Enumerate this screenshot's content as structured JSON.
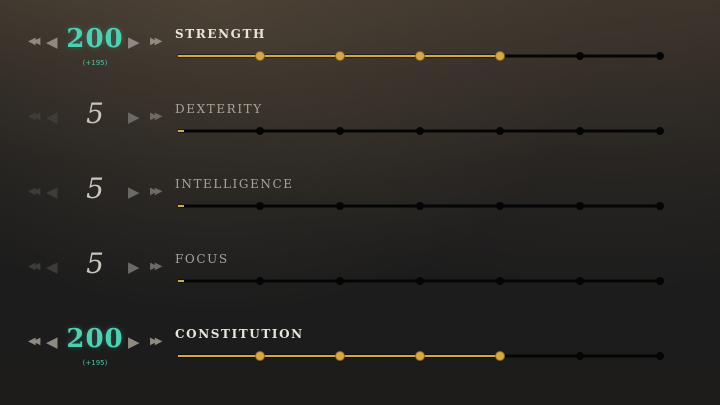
{
  "colors": {
    "accent_teal": "#4fd0b2",
    "gold": "#d4a847",
    "track_black": "#050505",
    "label_active": "#e8e4da",
    "label_inactive": "#a7a39b"
  },
  "icons": {
    "double_left": "double-chevron-left-icon",
    "single_left": "triangle-left-icon",
    "single_right": "triangle-right-icon",
    "double_right": "double-chevron-right-icon"
  },
  "glyphs": {
    "double_left": "◀◀",
    "single_left": "◀",
    "single_right": "▶",
    "double_right": "▶▶"
  },
  "track": {
    "nodes": 6
  },
  "attributes": [
    {
      "key": "strength",
      "name": "STRENGTH",
      "value": "200",
      "bonus": "(+195)",
      "active": true,
      "filled_nodes": 4
    },
    {
      "key": "dexterity",
      "name": "DEXTERITY",
      "value": "5",
      "bonus": "",
      "active": false,
      "filled_nodes": 0
    },
    {
      "key": "intelligence",
      "name": "INTELLIGENCE",
      "value": "5",
      "bonus": "",
      "active": false,
      "filled_nodes": 0
    },
    {
      "key": "focus",
      "name": "FOCUS",
      "value": "5",
      "bonus": "",
      "active": false,
      "filled_nodes": 0
    },
    {
      "key": "constitution",
      "name": "CONSTITUTION",
      "value": "200",
      "bonus": "(+195)",
      "active": true,
      "filled_nodes": 4
    }
  ]
}
